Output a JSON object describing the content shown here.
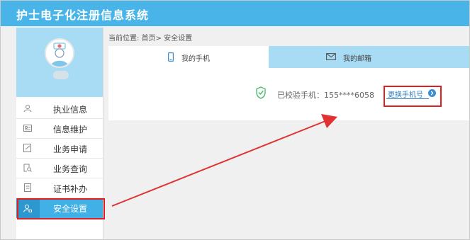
{
  "app": {
    "title": "护士电子化注册信息系统"
  },
  "breadcrumb": {
    "text": "当前位置: 首页> 安全设置"
  },
  "sidebar": {
    "items": [
      {
        "label": "执业信息",
        "icon": "person-badge-icon"
      },
      {
        "label": "信息维护",
        "icon": "id-card-icon"
      },
      {
        "label": "业务申请",
        "icon": "edit-form-icon"
      },
      {
        "label": "业务查询",
        "icon": "search-doc-icon"
      },
      {
        "label": "证书补办",
        "icon": "certificate-icon"
      },
      {
        "label": "安全设置",
        "icon": "user-lock-icon",
        "active": true
      }
    ]
  },
  "tabs": [
    {
      "label": "我的手机",
      "icon": "phone-icon",
      "active": true
    },
    {
      "label": "我的邮箱",
      "icon": "envelope-icon",
      "active": false
    }
  ],
  "phone": {
    "verified_text": "已校验手机：155****6058",
    "change_label": "更换手机号"
  },
  "colors": {
    "brand": "#48b4e8",
    "active_menu": "#41b0e6",
    "highlight": "#e02020"
  }
}
